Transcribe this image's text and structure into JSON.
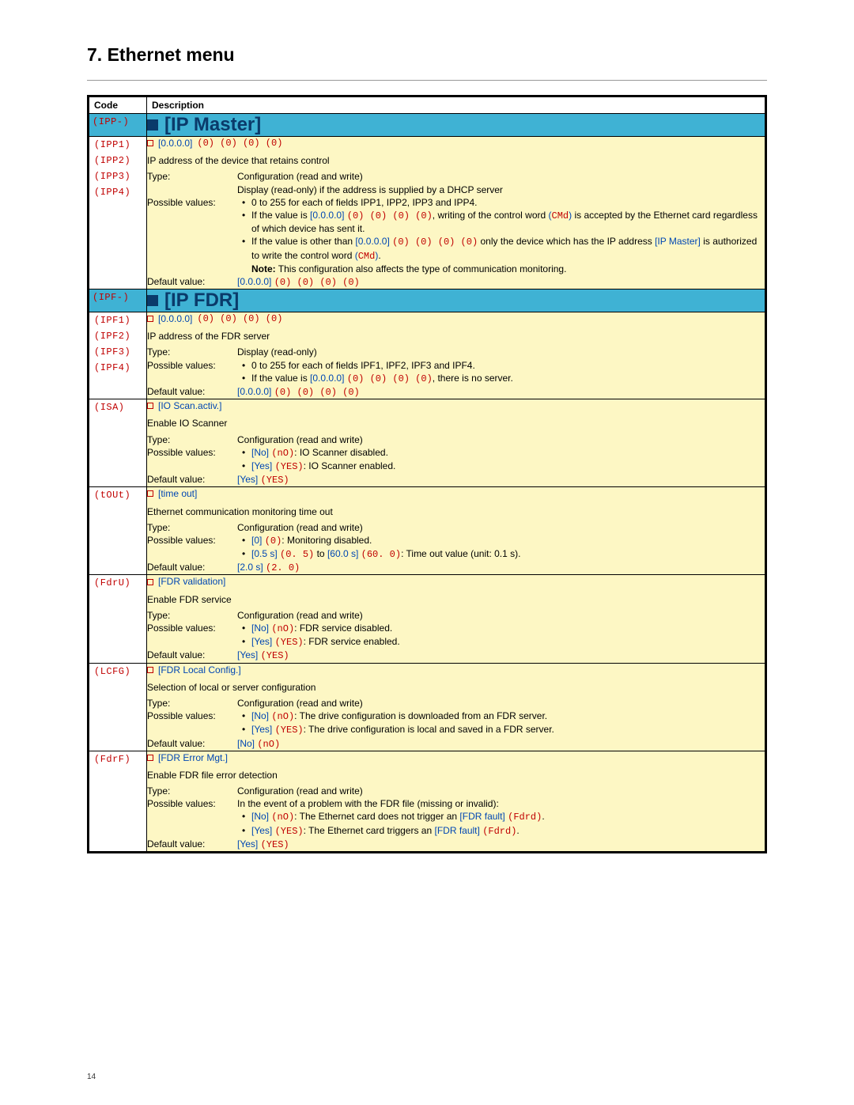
{
  "page": {
    "title": "7. Ethernet menu",
    "number": "14"
  },
  "columns": {
    "code": "Code",
    "desc": "Description"
  },
  "sections": [
    {
      "head_code": "(IPP-)",
      "head_title": "[IP Master]",
      "row": {
        "codes": [
          "(IPP1)",
          "(IPP2)",
          "(IPP3)",
          "(IPP4)"
        ],
        "title_value": "[0.0.0.0]",
        "title_red": "(0) (0) (0) (0)",
        "summary": "IP address of the device that retains control",
        "type_label": "Type:",
        "type_value": "Configuration (read and write)\nDisplay (read-only) if the address is supplied by a DHCP server",
        "pv_label": "Possible values:",
        "pv_lines": [
          {
            "text": [
              "0 to 255 for each of fields IPP1, IPP2, IPP3 and IPP4."
            ]
          },
          {
            "text": [
              "If the value is ",
              {
                "blue": "[0.0.0.0]"
              },
              " ",
              {
                "red": "(0) (0) (0) (0)"
              },
              ", writing of the control word ",
              {
                "blue": "("
              },
              {
                "red": "CMd"
              },
              {
                "blue": ")"
              },
              " is accepted by the Ethernet card regardless of which device has sent it."
            ]
          },
          {
            "text": [
              "If the value is other than ",
              {
                "blue": "[0.0.0.0]"
              },
              " ",
              {
                "red": "(0) (0) (0) (0)"
              },
              " only the device which has the IP address ",
              {
                "blue": "[IP Master]"
              },
              " is authorized to write the control word ",
              {
                "blue": "("
              },
              {
                "red": "CMd"
              },
              {
                "blue": ")"
              },
              ".",
              "\n",
              {
                "bold": "Note:"
              },
              " This configuration also affects the type of communication monitoring."
            ]
          }
        ],
        "default_label": "Default value:",
        "default_blue": "[0.0.0.0]",
        "default_red": "(0) (0) (0) (0)"
      }
    },
    {
      "head_code": "(IPF-)",
      "head_title": "[IP FDR]",
      "row": {
        "codes": [
          "(IPF1)",
          "(IPF2)",
          "(IPF3)",
          "(IPF4)"
        ],
        "title_value": "[0.0.0.0]",
        "title_red": "(0) (0) (0) (0)",
        "summary": "IP address of the FDR server",
        "type_label": "Type:",
        "type_value": "Display (read-only)",
        "pv_label": "Possible values:",
        "pv_lines": [
          {
            "text": [
              "0 to 255 for each of fields IPF1, IPF2, IPF3 and IPF4."
            ]
          },
          {
            "text": [
              "If the value is ",
              {
                "blue": "[0.0.0.0]"
              },
              " ",
              {
                "red": "(0) (0) (0) (0)"
              },
              ", there is no server."
            ]
          }
        ],
        "default_label": "Default value:",
        "default_blue": "[0.0.0.0]",
        "default_red": "(0) (0) (0) (0)"
      }
    }
  ],
  "rows": [
    {
      "code": "(ISA)",
      "title": "[IO Scan.activ.]",
      "summary": "Enable IO Scanner",
      "type_label": "Type:",
      "type_value": "Configuration (read and write)",
      "pv_label": "Possible values:",
      "pv_lines": [
        {
          "text": [
            {
              "blue": "[No]"
            },
            " ",
            {
              "red": "(nO)"
            },
            ": IO Scanner disabled."
          ]
        },
        {
          "text": [
            {
              "blue": "[Yes]"
            },
            " ",
            {
              "red": "(YES)"
            },
            ": IO Scanner enabled."
          ]
        }
      ],
      "default_label": "Default value:",
      "default_blue": "[Yes]",
      "default_red": "(YES)"
    },
    {
      "code": "(tOUt)",
      "title": "[time out]",
      "summary": "Ethernet communication monitoring time out",
      "type_label": "Type:",
      "type_value": "Configuration (read and write)",
      "pv_label": "Possible values:",
      "pv_lines": [
        {
          "text": [
            {
              "blue": "[0]"
            },
            " ",
            {
              "red": "(0)"
            },
            ": Monitoring disabled."
          ]
        },
        {
          "text": [
            {
              "blue": "[0.5 s]"
            },
            " ",
            {
              "red": "(0. 5)"
            },
            " to ",
            {
              "blue": "[60.0 s]"
            },
            " ",
            {
              "red": "(60. 0)"
            },
            ": Time out value (unit: 0.1 s)."
          ]
        }
      ],
      "default_label": "Default value:",
      "default_blue": "[2.0 s]",
      "default_red": "(2. 0)"
    },
    {
      "code": "(FdrU)",
      "title": "[FDR validation]",
      "summary": "Enable FDR service",
      "type_label": "Type:",
      "type_value": "Configuration (read and write)",
      "pv_label": "Possible values:",
      "pv_lines": [
        {
          "text": [
            {
              "blue": "[No]"
            },
            " ",
            {
              "red": "(nO)"
            },
            ": FDR service disabled."
          ]
        },
        {
          "text": [
            {
              "blue": "[Yes]"
            },
            " ",
            {
              "red": "(YES)"
            },
            ": FDR service enabled."
          ]
        }
      ],
      "default_label": "Default value:",
      "default_blue": "[Yes]",
      "default_red": "(YES)"
    },
    {
      "code": "(LCFG)",
      "title": "[FDR Local Config.]",
      "summary": "Selection of local or server configuration",
      "type_label": "Type:",
      "type_value": "Configuration (read and write)",
      "pv_label": "Possible values:",
      "pv_lines": [
        {
          "text": [
            {
              "blue": "[No]"
            },
            " ",
            {
              "red": "(nO)"
            },
            ": The drive configuration is downloaded from an FDR server."
          ]
        },
        {
          "text": [
            {
              "blue": "[Yes]"
            },
            " ",
            {
              "red": "(YES)"
            },
            ": The drive configuration is local and saved in a FDR server."
          ]
        }
      ],
      "default_label": "Default value:",
      "default_blue": "[No]",
      "default_red": "(nO)"
    },
    {
      "code": "(FdrF)",
      "title": "[FDR Error Mgt.]",
      "summary": "Enable FDR file error detection",
      "type_label": "Type:",
      "type_value": "Configuration (read and write)",
      "pv_label": "Possible values:",
      "pv_intro": "In the event of a problem with the FDR file (missing or invalid):",
      "pv_lines": [
        {
          "text": [
            {
              "blue": "[No]"
            },
            " ",
            {
              "red": "(nO)"
            },
            ": The Ethernet card does not trigger an ",
            {
              "blue": "[FDR fault]"
            },
            " ",
            {
              "red": "(Fdrd)"
            },
            "."
          ]
        },
        {
          "text": [
            {
              "blue": "[Yes]"
            },
            " ",
            {
              "red": "(YES)"
            },
            ": The Ethernet card triggers an ",
            {
              "blue": "[FDR fault]"
            },
            " ",
            {
              "red": "(Fdrd)"
            },
            "."
          ]
        }
      ],
      "default_label": "Default value:",
      "default_blue": "[Yes]",
      "default_red": "(YES)"
    }
  ]
}
